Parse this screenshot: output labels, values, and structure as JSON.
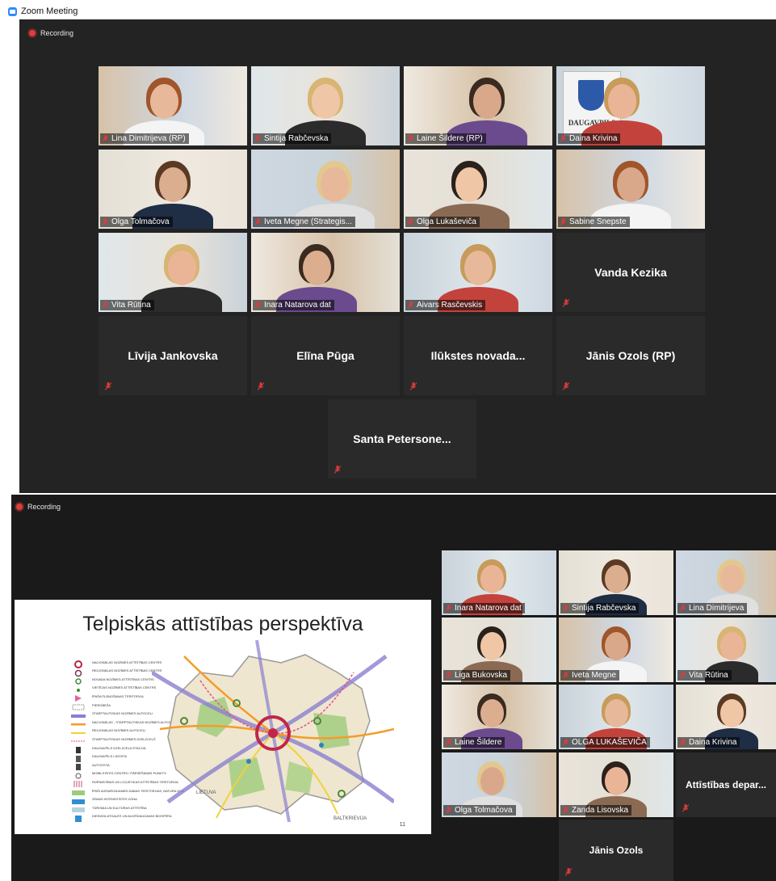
{
  "window": {
    "title": "Zoom Meeting"
  },
  "recording_label": "Recording",
  "meeting1": {
    "video_tiles": [
      {
        "name": "Lina Dimitrijeva (RP)",
        "active": false
      },
      {
        "name": "Sintija Rabčevska",
        "active": false
      },
      {
        "name": "Laine Šildere (RP)",
        "active": false
      },
      {
        "name": "Daina Krivina",
        "active": true
      },
      {
        "name": "Olga Tolmačova",
        "active": false
      },
      {
        "name": "Iveta Megne (Strategis...",
        "active": false
      },
      {
        "name": "Olga Lukaševiča",
        "active": false
      },
      {
        "name": "Sabine Snepste",
        "active": false
      },
      {
        "name": "Vita Rūtina",
        "active": false
      },
      {
        "name": "Inara Natarova dat",
        "active": false
      },
      {
        "name": "Aivars Rasčevskis",
        "active": false
      }
    ],
    "name_tiles": [
      {
        "name": "Vanda Kezika"
      },
      {
        "name": "Līvija Jankovska"
      },
      {
        "name": "Elīna Pūga"
      },
      {
        "name": "Ilūkstes novada..."
      },
      {
        "name": "Jānis Ozols (RP)"
      },
      {
        "name": "Santa Petersone..."
      }
    ],
    "daugavpils_sign": "DAUGAVPILS"
  },
  "slide": {
    "title": "Telpiskās attīstības perspektīva",
    "page_number": "11",
    "map_label_country": "LIETUVA",
    "map_label_region": "BALTKRIEVIJA",
    "legend": [
      "NACIONĀLAS NOZĪMES ATTĪSTĪBAS CENTRS",
      "REĢIONĀLAS NOZĪMES ATTĪSTĪBAS CENTRS",
      "NOVADA NOZĪMES ATTĪSTĪBAS CENTRS",
      "VIETĒJAS NOZĪMES ATTĪSTĪBAS CENTRS",
      "ĪPAŠA PLĀNOŠANAS TERITORIJA",
      "PIEROBEŽA",
      "STARPTAUTISKAS NOZĪMES AUTOCEĻI",
      "NACIONĀLAS - STARPTAUTISKAS NOZĪMES AUTOCEĻI",
      "REĢIONĀLAS NOZĪMES AUTOCEĻI",
      "STARPTAUTISKAS NOZĪMES DZELZCEĻŠ",
      "DAUGAVPILS DZELZCEĻA STACIJA",
      "DAUGAVPILS LIDOSTA",
      "AUTOOSTA",
      "MOBILITĀTES CENTRS / PĀRSĒŠANĀS PUNKTS",
      "RŪPNIECĪBAS UN LOĢISTIKAS ATTĪSTĪBAS TERITORIJA",
      "ĪPAŠI AIZSARGĀJAMĀS DABAS TERITORIJAS, NATURA 2000",
      "ZEMAS INTENSITĀTES ZONA",
      "TŪRISMA UN KULTŪRAS ATTĪSTĪBA",
      "DIENVIDLATGALES UN AUGŠDAUGAVAS BIOSFĒRA"
    ]
  },
  "meeting2": {
    "video_tiles": [
      {
        "name": "Inara Natarova dat",
        "active": false
      },
      {
        "name": "Sintija Rabčevska",
        "active": false
      },
      {
        "name": "Lina Dimitrijeva",
        "active": false
      },
      {
        "name": "Liga Bukovska",
        "active": false
      },
      {
        "name": "Iveta Megne",
        "active": false
      },
      {
        "name": "Vita Rūtina",
        "active": true
      },
      {
        "name": "Laine Šildere",
        "active": false
      },
      {
        "name": "OLGA LUKAŠEVIČA",
        "active": false
      },
      {
        "name": "Daina Krivina",
        "active": false
      },
      {
        "name": "Olga Tolmačova",
        "active": false
      },
      {
        "name": "Zanda Lisovska",
        "active": false
      }
    ],
    "name_tiles": [
      {
        "name": "Attīstības depar..."
      },
      {
        "name": "Jānis Ozols"
      }
    ]
  }
}
